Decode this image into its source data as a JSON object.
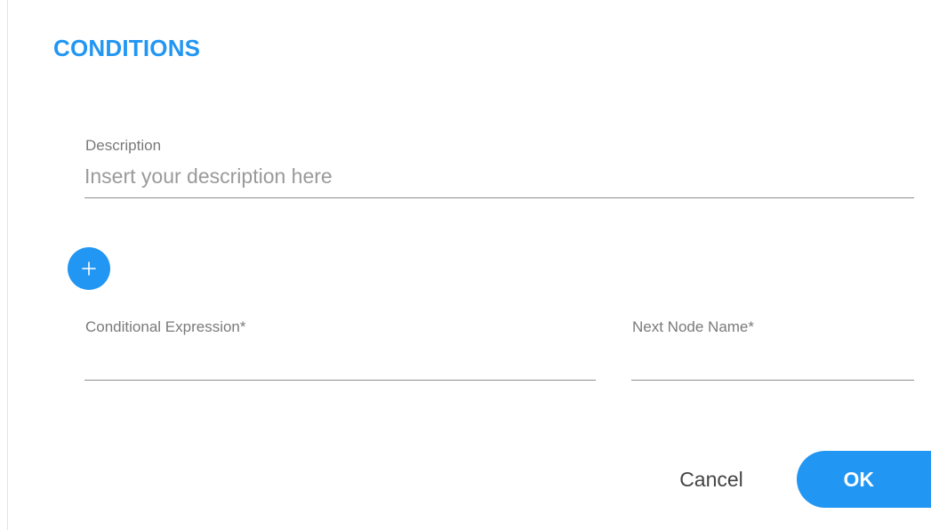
{
  "dialog": {
    "title": "CONDITIONS",
    "accent_color": "#2196f3"
  },
  "description": {
    "label": "Description",
    "placeholder": "Insert your description here",
    "value": ""
  },
  "add_button": {
    "icon": "plus-icon"
  },
  "conditional_expression": {
    "label": "Conditional Expression*",
    "value": ""
  },
  "next_node_name": {
    "label": "Next Node Name*",
    "value": ""
  },
  "actions": {
    "cancel_label": "Cancel",
    "ok_label": "OK"
  }
}
